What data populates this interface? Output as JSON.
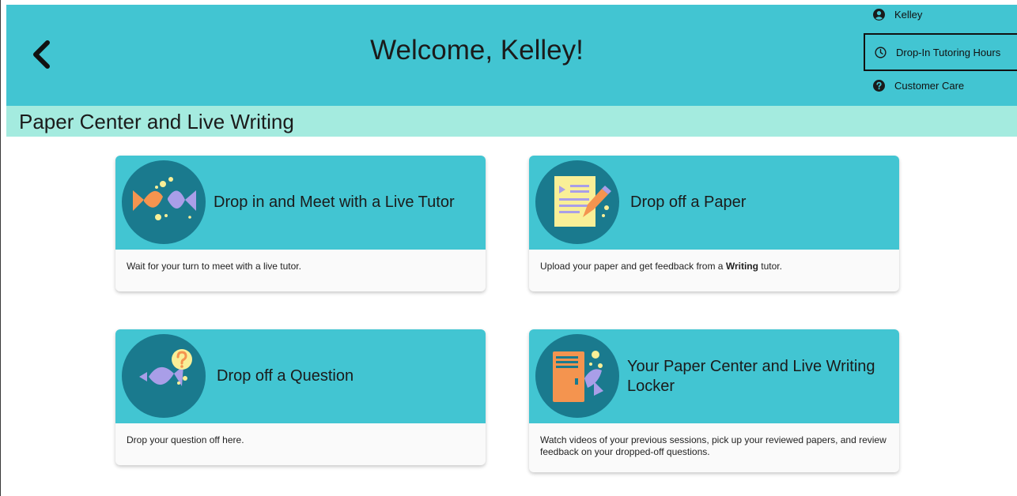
{
  "header": {
    "welcome": "Welcome, Kelley!",
    "back_icon": "chevron-left-icon"
  },
  "user_menu": {
    "user_name": "Kelley",
    "hours_label": "Drop-In Tutoring Hours",
    "care_label": "Customer Care"
  },
  "section": {
    "title": "Paper Center and Live Writing"
  },
  "cards": [
    {
      "title": "Drop in and Meet with a Live Tutor",
      "description": "Wait for your turn to meet with a live tutor.",
      "icon": "fish-icon"
    },
    {
      "title": "Drop off a Paper",
      "description_pre": "Upload your paper and get feedback from a ",
      "description_bold": "Writing",
      "description_post": " tutor.",
      "icon": "paper-pencil-icon"
    },
    {
      "title": "Drop off a Question",
      "description": "Drop your question off here.",
      "icon": "question-fish-icon"
    },
    {
      "title": "Your Paper Center and Live Writing Locker",
      "description": "Watch videos of your previous sessions, pick up your reviewed papers, and review feedback on your dropped-off questions.",
      "icon": "locker-icon"
    }
  ],
  "colors": {
    "header_bg": "#42c5d2",
    "section_bg": "#a4ebdf",
    "icon_circle": "#1a7a8e",
    "fish_orange": "#f4944f",
    "fish_purple": "#a99ee8",
    "accent_yellow": "#f9ef97"
  }
}
